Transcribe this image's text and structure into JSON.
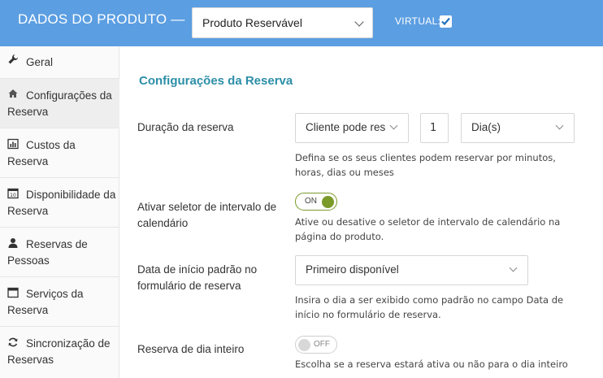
{
  "header": {
    "title": "DADOS DO PRODUTO —",
    "product_type": "Produto Reservável",
    "virtual_label": "VIRTUAL:",
    "virtual_checked": true
  },
  "sidebar": {
    "items": [
      {
        "label": "Geral",
        "icon": "wrench-icon"
      },
      {
        "label": "Configurações da Reserva",
        "icon": "home-icon"
      },
      {
        "label": "Custos da Reserva",
        "icon": "bar-chart-icon"
      },
      {
        "label": "Disponibilidade da Reserva",
        "icon": "calendar-icon"
      },
      {
        "label": "Reservas de Pessoas",
        "icon": "person-icon"
      },
      {
        "label": "Serviços da Reserva",
        "icon": "window-icon"
      },
      {
        "label": "Sincronização de Reservas",
        "icon": "sync-icon"
      }
    ],
    "active_index": 1
  },
  "main": {
    "section_title": "Configurações da Reserva",
    "fields": {
      "duration": {
        "label": "Duração da reserva",
        "type_value": "Cliente pode res",
        "amount": "1",
        "unit_value": "Dia(s)",
        "help": "Defina se os seus clientes podem reservar por minutos, horas, dias ou meses"
      },
      "range_picker": {
        "label": "Ativar seletor de intervalo de calendário",
        "toggle_text": "ON",
        "help": "Ative ou desative o seletor de intervalo de calendário na página do produto."
      },
      "start_date": {
        "label": "Data de início padrão no formulário de reserva",
        "value": "Primeiro disponível",
        "help": "Insira o dia a ser exibido como padrão no campo Data de início no formulário de reserva."
      },
      "full_day": {
        "label": "Reserva de dia inteiro",
        "toggle_text": "OFF",
        "help": "Escolha se a reserva estará ativa ou não para o dia inteiro"
      }
    }
  },
  "colors": {
    "header_bg": "#5b9ee2",
    "accent_title": "#2c8ea8",
    "toggle_on": "#7a9a2a"
  }
}
